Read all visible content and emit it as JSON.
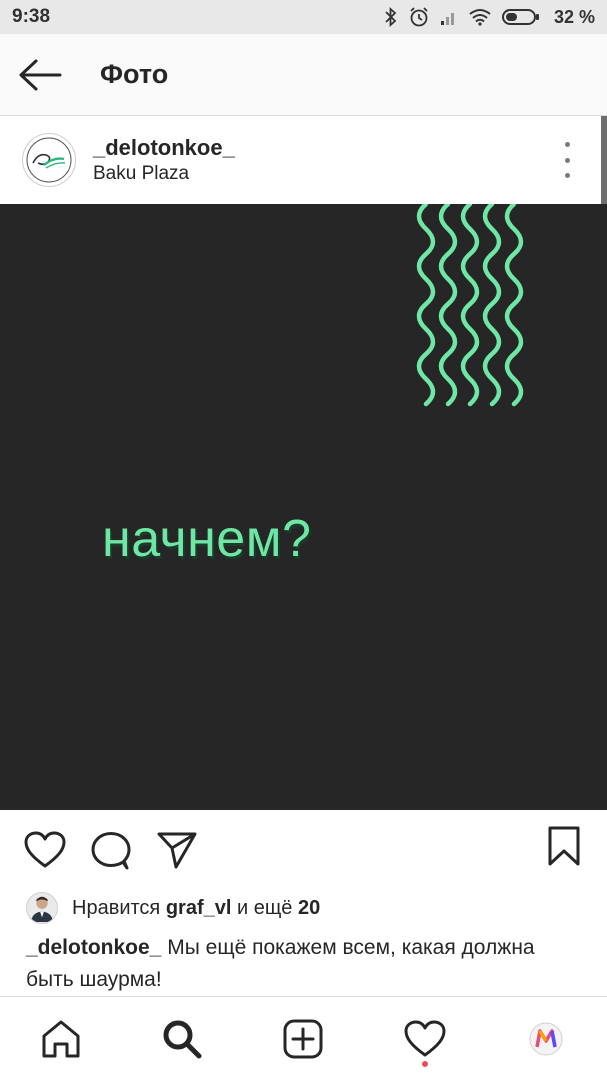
{
  "status_bar": {
    "time": "9:38",
    "battery": "32 %",
    "icons": [
      "bluetooth-icon",
      "alarm-icon",
      "signal-icon",
      "wifi-icon",
      "battery-icon"
    ]
  },
  "header": {
    "title": "Фото",
    "back_icon": "arrow-left-icon"
  },
  "post": {
    "username": "_delotonkoe_",
    "location": "Baku Plaza",
    "image_text": "начнем?",
    "accent_color": "#6ee7a4",
    "background_color": "#262626"
  },
  "likes": {
    "prefix": "Нравится",
    "user": "graf_vl",
    "middle": "и ещё",
    "count": "20"
  },
  "caption": {
    "username": "_delotonkoe_",
    "text": "Мы ещё покажем всем, какая должна быть шаурма!"
  },
  "bottom_nav": {
    "items": [
      "home-icon",
      "search-icon",
      "add-post-icon",
      "activity-heart-icon",
      "profile-icon"
    ]
  }
}
